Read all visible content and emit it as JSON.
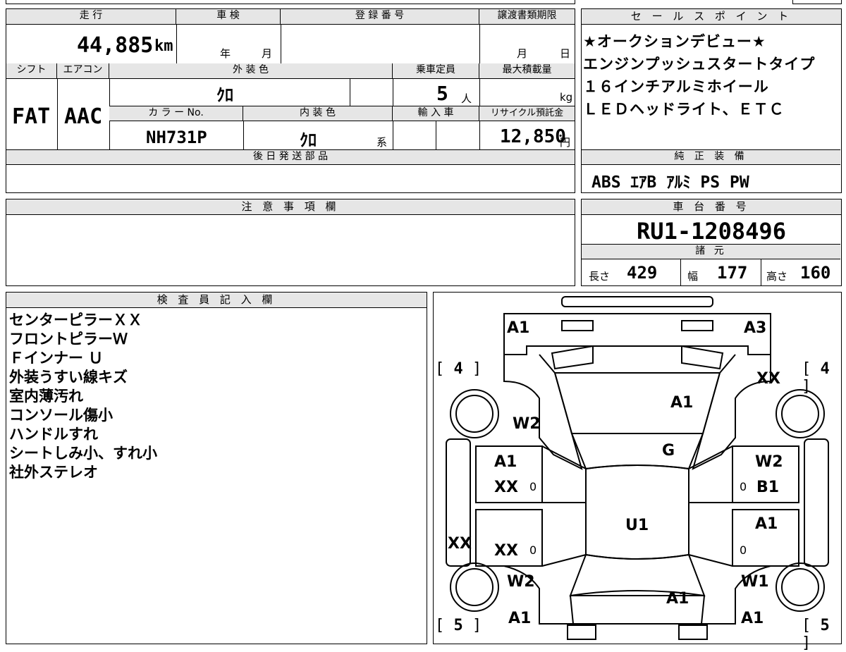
{
  "top": {
    "mileage": {
      "label": "走 行",
      "value": "44,885",
      "unit": "km"
    },
    "inspection": {
      "label": "車 検",
      "year_unit": "年",
      "month_unit": "月"
    },
    "registration": {
      "label": "登 録 番 号"
    },
    "transfer_deadline": {
      "label": "譲渡書類期限",
      "month_unit": "月",
      "day_unit": "日"
    },
    "shift": {
      "label": "シフト",
      "value": "FAT"
    },
    "aircon": {
      "label": "エアコン",
      "value": "AAC"
    },
    "exterior_color": {
      "label": "外 装 色",
      "value": "ｸﾛ"
    },
    "capacity": {
      "label": "乗車定員",
      "value": "5",
      "unit": "人"
    },
    "max_load": {
      "label": "最大積載量",
      "unit": "kg"
    },
    "color_no": {
      "label": "カ ラ ー No.",
      "value": "NH731P"
    },
    "interior_color": {
      "label": "内 装 色",
      "value": "ｸﾛ",
      "suffix": "系"
    },
    "import": {
      "label": "輸 入 車"
    },
    "recycle": {
      "label": "リサイクル預託金",
      "value": "12,850",
      "unit": "円"
    },
    "later_parts": {
      "label": "後 日 発 送 部 品"
    }
  },
  "sales_point": {
    "label": "セ ー ル ス ポ イ ン ト",
    "lines": [
      "★オークションデビュー★",
      "エンジンプッシュスタートタイプ",
      "１６インチアルミホイール",
      "ＬＥＤヘッドライト、ＥＴＣ"
    ]
  },
  "equipment": {
    "label": "純 正 装 備",
    "value": "ABS ｴｱB ｱﾙﾐ PS PW"
  },
  "caution": {
    "label": "注 意 事 項 欄"
  },
  "chassis": {
    "label": "車 台 番 号",
    "value": "RU1-1208496"
  },
  "specs": {
    "label": "諸 元",
    "length_label": "長さ",
    "length": "429",
    "width_label": "幅",
    "width": "177",
    "height_label": "高さ",
    "height": "160"
  },
  "inspector": {
    "label": "検 査 員 記 入 欄",
    "notes": [
      "センターピラーＸＸ",
      "フロントピラーＷ",
      "Ｆインナー Ｕ",
      "外装うすい線キズ",
      "室内薄汚れ",
      "コンソール傷小",
      "ハンドルすれ",
      "シートしみ小、すれ小",
      "社外ステレオ"
    ]
  },
  "diagram": {
    "tires": {
      "front_left": "4",
      "front_right": "4",
      "rear_left": "5",
      "rear_right": "5"
    },
    "marks": {
      "front_bumper_left": "A1",
      "front_bumper_right": "A3",
      "front_fender_right": "XX",
      "hood": "A1",
      "front_fender_left": "W2",
      "windshield": "G",
      "front_door_left_1": "A1",
      "front_door_left_2": "XX",
      "front_door_right_1": "W2",
      "front_door_right_2": "B1",
      "roof": "U1",
      "rear_door_left": "XX",
      "rear_door_right": "A1",
      "pillar_left": "XX",
      "rear_fender_left": "W2",
      "rear_fender_right": "W1",
      "trunk": "A1",
      "rear_bumper_left": "A1",
      "rear_bumper_right": "A1"
    },
    "zero": "0"
  }
}
